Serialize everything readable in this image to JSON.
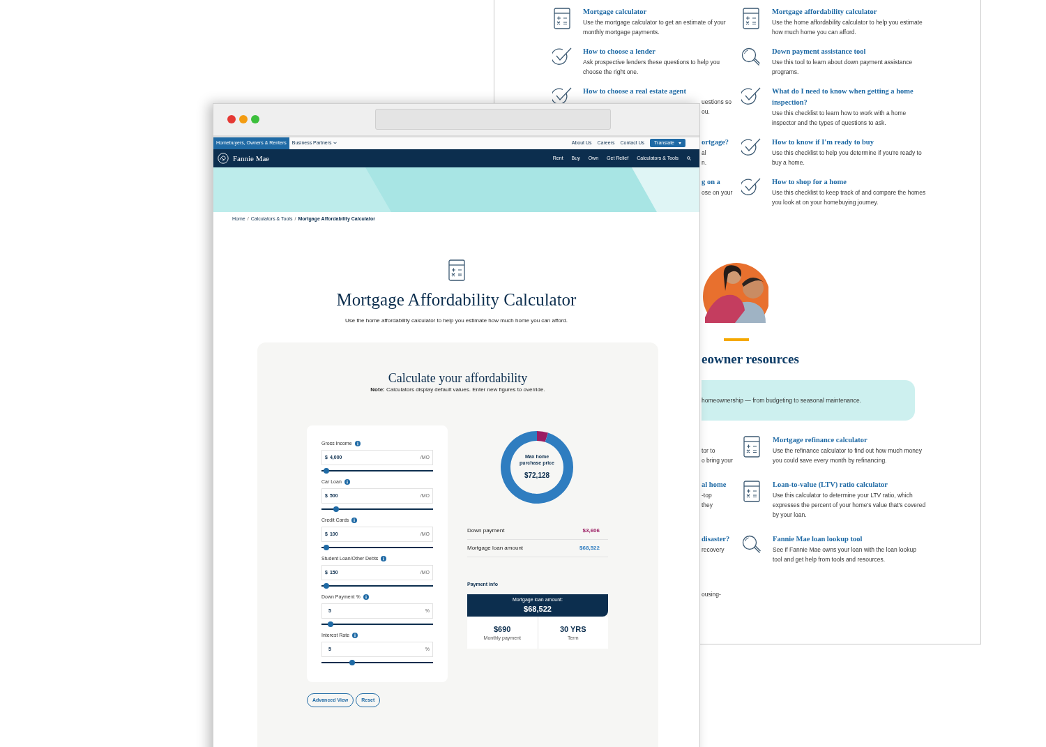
{
  "back_window": {
    "resource_rows": [
      {
        "left": {
          "kind": "calculator",
          "title": "Mortgage calculator",
          "description": "Use the mortgage calculator to get an estimate of your monthly mortgage payments."
        },
        "right": {
          "kind": "calculator",
          "title": "Mortgage affordability calculator",
          "description": "Use the home affordability calculator to help you estimate how much home you can afford."
        }
      },
      {
        "left": {
          "kind": "checklist",
          "title": "How to choose a lender",
          "description": "Ask prospective lenders these questions to help you choose the right one."
        },
        "right": {
          "kind": "search",
          "title": "Down payment assistance tool",
          "description": "Use this tool to learn about down payment assistance programs."
        }
      },
      {
        "left": {
          "kind": "checklist",
          "title": "How to choose a real estate agent",
          "description_fragments": [
            "uestions so",
            "ou."
          ]
        },
        "right": {
          "kind": "checklist",
          "title": "What do I need to know when getting a home inspection?",
          "description": "Use this checklist to learn how to work with a home inspector and the types of questions to ask."
        }
      },
      {
        "left": {
          "kind": "hidden",
          "title_fragment": "ortgage?",
          "description_fragments": [
            "al",
            "n."
          ]
        },
        "right": {
          "kind": "checklist",
          "title": "How to know if I'm ready to buy",
          "description": "Use this checklist to help you determine if you're ready to buy a home."
        }
      },
      {
        "left": {
          "kind": "hidden",
          "title_fragment": "g on a",
          "description_fragments": [
            "ose on your"
          ]
        },
        "right": {
          "kind": "checklist",
          "title": "How to shop for a home",
          "description": "Use this checklist to keep track of and compare the homes you look at on your homebuying journey."
        }
      }
    ],
    "section_heading": "eowner resources",
    "banner_text": "homeownership — from budgeting to seasonal maintenance.",
    "lower_rows": [
      {
        "left": {
          "lines": [
            "tor to",
            "o bring your"
          ]
        },
        "right": {
          "kind": "calculator",
          "title": "Mortgage refinance calculator",
          "description": "Use the refinance calculator to find out how much money you could save every month by refinancing."
        }
      },
      {
        "left": {
          "title_fragment": "al home",
          "lines": [
            "-top",
            "they"
          ]
        },
        "right": {
          "kind": "calculator",
          "title": "Loan-to-value (LTV) ratio calculator",
          "description": "Use this calculator to determine your LTV ratio, which expresses the percent of your home's value that's covered by your loan."
        }
      },
      {
        "left": {
          "title_fragment": "disaster?",
          "lines": [
            "recovery"
          ]
        },
        "right": {
          "kind": "search",
          "title": "Fannie Mae loan lookup tool",
          "description": "See if Fannie Mae owns your loan with the loan lookup tool and get help from tools and resources."
        }
      },
      {
        "left": {
          "lines": [
            "ousing-"
          ]
        }
      }
    ]
  },
  "front_window": {
    "audience_tabs": [
      {
        "label": "Homebuyers, Owners & Renters",
        "selected": true
      },
      {
        "label": "Business Partners",
        "selected": false
      }
    ],
    "utility_links": [
      "About Us",
      "Careers",
      "Contact Us"
    ],
    "translate_button": "Translate",
    "logo_text": "Fannie Mae",
    "nav_items": [
      "Rent",
      "Buy",
      "Own",
      "Get Relief",
      "Calculators & Tools"
    ],
    "breadcrumb": [
      {
        "kind": "link",
        "text": "Home"
      },
      {
        "kind": "separator",
        "text": "/"
      },
      {
        "kind": "link",
        "text": "Calculators & Tools"
      },
      {
        "kind": "separator",
        "text": "/"
      },
      {
        "kind": "current",
        "text": "Mortgage Affordability Calculator"
      }
    ],
    "title": "Mortgage Affordability Calculator",
    "subtitle": "Use the home affordability calculator to help you estimate how much home you can afford.",
    "calculator": {
      "heading": "Calculate your affordability",
      "note": "**Note:** Calculators display default values. Enter new figures to override.",
      "fields": [
        {
          "label": "Gross Income",
          "prefix": "$",
          "value": "4,000",
          "suffix": "/MO",
          "level": 0.03
        },
        {
          "label": "Car Loan",
          "prefix": "$",
          "value": "500",
          "suffix": "/MO",
          "level": 0.12
        },
        {
          "label": "Credit Cards",
          "prefix": "$",
          "value": "100",
          "suffix": "/MO",
          "level": 0.03
        },
        {
          "label": "Student Loan/Other Debts",
          "prefix": "$",
          "value": "150",
          "suffix": "/MO",
          "level": 0.03
        },
        {
          "label": "Down Payment %",
          "value": "5",
          "suffix": "%",
          "level": 0.07
        },
        {
          "label": "Interest Rate",
          "value": "5",
          "suffix": "%",
          "level": 0.26
        }
      ],
      "donut": {
        "caption": "Max home purchase price",
        "value": "$72,128",
        "chart_data": {
          "type": "donut",
          "values": [
            5,
            95
          ]
        }
      },
      "summary_rows": [
        {
          "label": "Down payment",
          "value": "$3,606",
          "color": "#9b1d63"
        },
        {
          "label": "Mortgage loan amount",
          "value": "$68,522",
          "color": "#2f7dc0"
        }
      ],
      "payment_info": {
        "heading": "Payment info",
        "banner_label": "Mortgage loan amount:",
        "banner_value": "$68,522",
        "cells": [
          {
            "value": "$690",
            "label": "Monthly payment"
          },
          {
            "value": "30 YRS",
            "label": "Term"
          }
        ]
      },
      "buttons": [
        "Advanced View",
        "Reset"
      ]
    }
  }
}
